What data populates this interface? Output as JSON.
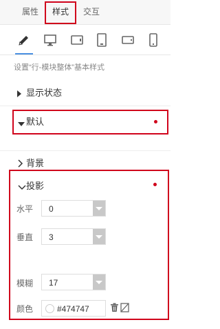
{
  "tabs": {
    "attributes": "属性",
    "style": "样式",
    "interaction": "交互"
  },
  "devices": [
    "edit-pencil-icon",
    "desktop-icon",
    "tablet-landscape-icon",
    "tablet-portrait-icon",
    "phone-landscape-icon",
    "phone-portrait-icon"
  ],
  "description": "设置“行-模块整体”基本样式",
  "sections": {
    "display_state": "显示状态",
    "default": "默认",
    "background": "背景",
    "shadow": "投影"
  },
  "shadow": {
    "horizontal_label": "水平",
    "horizontal_value": "0",
    "vertical_label": "垂直",
    "vertical_value": "3",
    "blur_label": "模糊",
    "blur_value": "17",
    "color_label": "颜色",
    "color_value": "#474747"
  },
  "colors": {
    "accent": "#4a90e2",
    "highlight": "#d0021b",
    "shadow_color": "#474747"
  }
}
